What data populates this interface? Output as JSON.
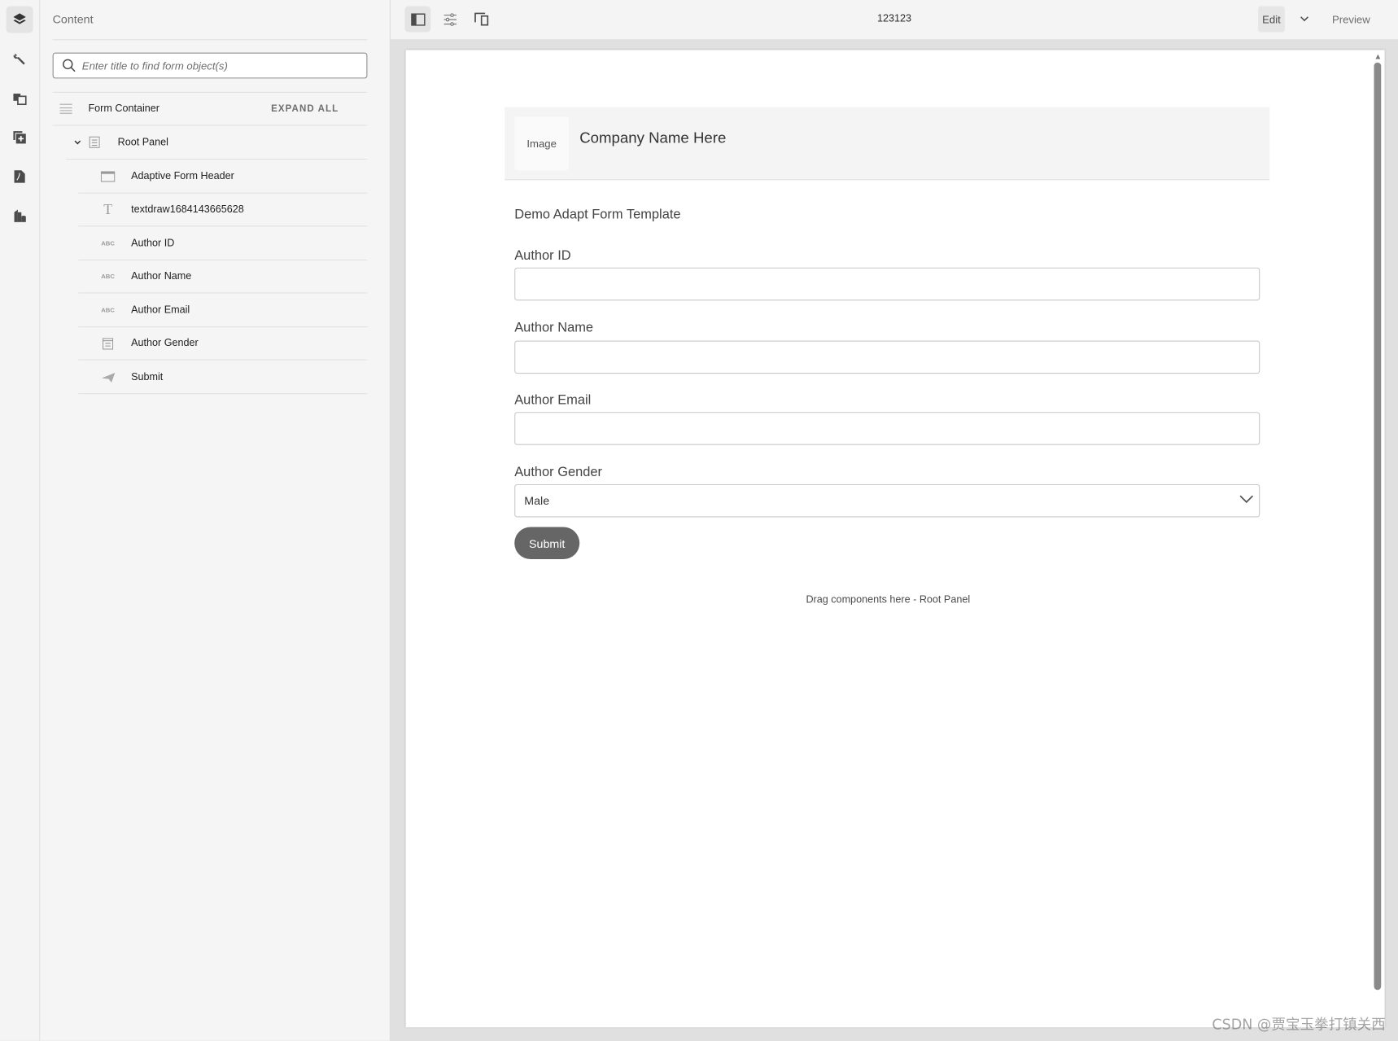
{
  "rail": {
    "icons": [
      "layers-icon",
      "wrench-icon",
      "assets-icon",
      "add-component-icon",
      "pdf-icon",
      "data-source-icon"
    ]
  },
  "panel": {
    "title": "Content",
    "search_placeholder": "Enter title to find form object(s)",
    "root_label": "Form Container",
    "expand_all": "EXPAND ALL",
    "root_panel": "Root Panel",
    "items": [
      {
        "label": "Adaptive Form Header",
        "icon": "header-icon"
      },
      {
        "label": "textdraw1684143665628",
        "icon": "text-icon"
      },
      {
        "label": "Author ID",
        "icon": "abc-icon"
      },
      {
        "label": "Author Name",
        "icon": "abc-icon"
      },
      {
        "label": "Author Email",
        "icon": "abc-icon"
      },
      {
        "label": "Author Gender",
        "icon": "dropdown-list-icon"
      },
      {
        "label": "Submit",
        "icon": "send-icon"
      }
    ]
  },
  "toolbar": {
    "title": "123123",
    "edit": "Edit",
    "preview": "Preview"
  },
  "form": {
    "image_placeholder": "Image",
    "company": "Company Name Here",
    "title": "Demo Adapt Form Template",
    "author_id_label": "Author ID",
    "author_id_value": "",
    "author_name_label": "Author Name",
    "author_name_value": "",
    "author_email_label": "Author Email",
    "author_email_value": "",
    "author_gender_label": "Author Gender",
    "author_gender_value": "Male",
    "submit": "Submit",
    "drag_hint": "Drag components here - Root Panel"
  },
  "watermark": "CSDN @贾宝玉拳打镇关西",
  "colors": {
    "submit_bg": "#666666",
    "panel_bg": "#f5f5f5",
    "canvas_bg": "#e0e0e0"
  }
}
